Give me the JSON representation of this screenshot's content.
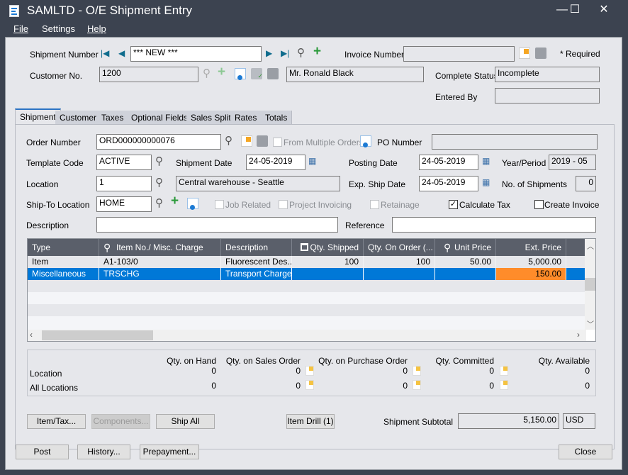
{
  "window": {
    "title": "SAMLTD - O/E Shipment Entry",
    "controls": {
      "minimize": "—",
      "maximize": "☐",
      "close": "✕"
    }
  },
  "menu": [
    {
      "label": "File",
      "accel": "F"
    },
    {
      "label": "Settings",
      "accel": ""
    },
    {
      "label": "Help",
      "accel": "H"
    }
  ],
  "header": {
    "shipment_number_label": "Shipment Number",
    "shipment_number_value": "*** NEW ***",
    "invoice_number_label": "Invoice Number",
    "invoice_number_value": "",
    "required_note": "*  Required",
    "customer_no_label": "Customer No.",
    "customer_no_value": "1200",
    "customer_name": "Mr. Ronald Black",
    "complete_status_label": "Complete Status",
    "complete_status_value": "Incomplete",
    "entered_by_label": "Entered By",
    "entered_by_value": ""
  },
  "tabs": [
    {
      "label": "Shipment",
      "active": true
    },
    {
      "label": "Customer",
      "active": false
    },
    {
      "label": "Taxes",
      "active": false
    },
    {
      "label": "Optional Fields",
      "active": false
    },
    {
      "label": "Sales Split",
      "active": false
    },
    {
      "label": "Rates",
      "active": false
    },
    {
      "label": "Totals",
      "active": false
    }
  ],
  "shipment": {
    "order_number_label": "Order Number",
    "order_number_value": "ORD000000000076",
    "from_multiple_orders_label": "From Multiple Orders",
    "from_multiple_orders_checked": false,
    "po_number_label": "PO Number",
    "po_number_value": "",
    "template_code_label": "Template Code",
    "template_code_value": "ACTIVE",
    "shipment_date_label": "Shipment Date",
    "shipment_date_value": "24-05-2019",
    "posting_date_label": "Posting Date",
    "posting_date_value": "24-05-2019",
    "year_period_label": "Year/Period",
    "year_period_value": "2019 - 05",
    "location_label": "Location",
    "location_value": "1",
    "location_desc": "Central warehouse - Seattle",
    "exp_ship_date_label": "Exp. Ship Date",
    "exp_ship_date_value": "24-05-2019",
    "no_of_shipments_label": "No. of Shipments",
    "no_of_shipments_value": "0",
    "ship_to_label": "Ship-To Location",
    "ship_to_value": "HOME",
    "job_related_label": "Job Related",
    "project_invoicing_label": "Project Invoicing",
    "retainage_label": "Retainage",
    "calculate_tax_label": "Calculate Tax",
    "calculate_tax_checked": true,
    "create_invoice_label": "Create Invoice",
    "create_invoice_checked": false,
    "description_label": "Description",
    "description_value": "",
    "reference_label": "Reference",
    "reference_value": ""
  },
  "grid": {
    "columns": [
      "Type",
      "Item No./ Misc. Charge",
      "Description",
      "Qty. Shipped",
      "Qty. On Order (...",
      "Unit Price",
      "Ext. Price"
    ],
    "rows": [
      [
        "Item",
        "A1-103/0",
        "Fluorescent Des...",
        "100",
        "100",
        "50.00",
        "5,000.00"
      ],
      [
        "Miscellaneous",
        "TRSCHG",
        "Transport Charges",
        "",
        "",
        "",
        "150.00"
      ]
    ],
    "selected_row": 1,
    "colors": {
      "header_bg": "#5a5f6a",
      "selected_bg": "#0078d7",
      "edit_cell_bg": "#ff8c2a"
    }
  },
  "quantities": {
    "columns": [
      "Qty. on Hand",
      "Qty. on Sales Order",
      "Qty. on Purchase Order",
      "Qty. Committed",
      "Qty. Available"
    ],
    "rows": [
      {
        "label": "Location",
        "values": [
          "0",
          "0",
          "0",
          "0",
          "0"
        ]
      },
      {
        "label": "All Locations",
        "values": [
          "0",
          "0",
          "0",
          "0",
          "0"
        ]
      }
    ]
  },
  "actions": {
    "item_tax": "Item/Tax...",
    "components": "Components...",
    "ship_all": "Ship All",
    "item_drill": "Item Drill (1)",
    "subtotal_label": "Shipment Subtotal",
    "subtotal_value": "5,150.00",
    "currency": "USD"
  },
  "footer": {
    "post": "Post",
    "history": "History...",
    "prepayment": "Prepayment...",
    "close": "Close"
  }
}
